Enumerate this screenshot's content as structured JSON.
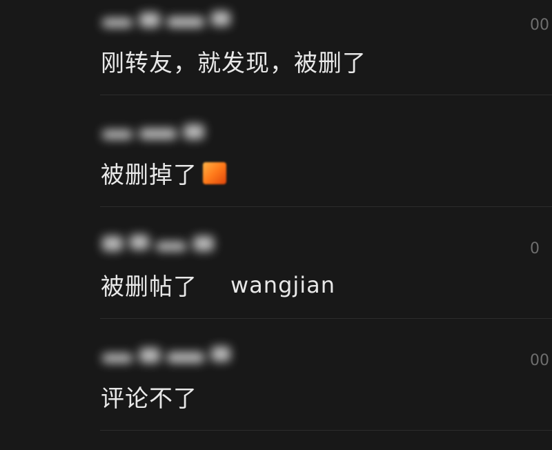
{
  "comments": [
    {
      "time": "00",
      "text": "刚转友，就发现，被删了"
    },
    {
      "time": "",
      "text": "被删掉了",
      "emoji": "orange-square-emoji"
    },
    {
      "time": "0",
      "text": "被删帖了",
      "mention": "wangjian"
    },
    {
      "time": "00",
      "text": "评论不了"
    }
  ],
  "colors": {
    "background": "#181818",
    "text": "#e8e8e8",
    "timestamp": "#6e6e6e",
    "divider": "#2c2c2c"
  }
}
